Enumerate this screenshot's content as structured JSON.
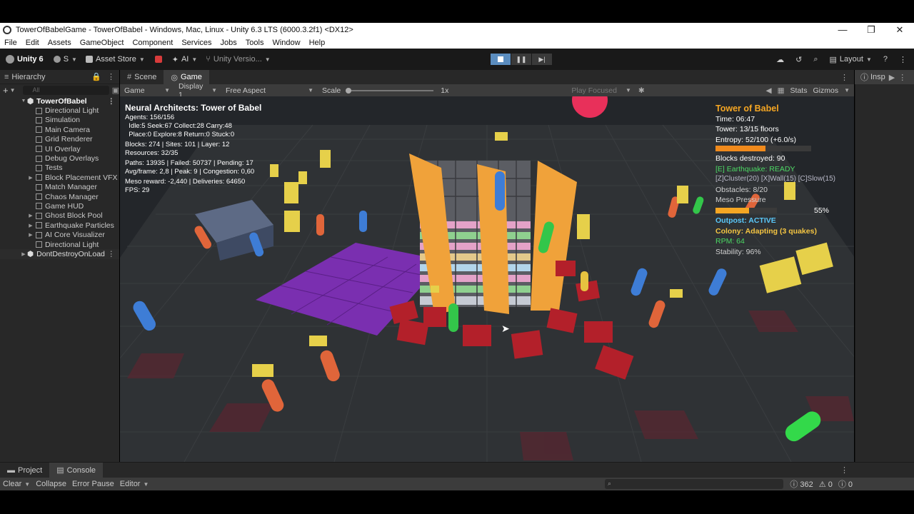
{
  "window": {
    "title": "TowerOfBabelGame - TowerOfBabel - Windows, Mac, Linux - Unity 6.3 LTS (6000.3.2f1) <DX12>",
    "controls": [
      "—",
      "❐",
      "✕"
    ]
  },
  "menu": [
    "File",
    "Edit",
    "Assets",
    "GameObject",
    "Component",
    "Services",
    "Jobs",
    "Tools",
    "Window",
    "Help"
  ],
  "toolbar": {
    "unity_label": "Unity 6",
    "account_label": "S",
    "asset_store_label": "Asset Store",
    "ai_label": "AI",
    "version_control_label": "Unity Versio...",
    "layout_label": "Layout"
  },
  "hierarchy": {
    "tab_label": "Hierarchy",
    "search_placeholder": "All",
    "root": "TowerOfBabel",
    "items": [
      "Directional Light",
      "Simulation",
      "Main Camera",
      "Grid Renderer",
      "UI Overlay",
      "Debug Overlays",
      "Tests",
      "Block Placement VFX",
      "Match Manager",
      "Chaos Manager",
      "Game HUD",
      "Ghost Block Pool",
      "Earthquake Particles",
      "AI Core Visualizer",
      "Directional Light"
    ],
    "expandable": [
      false,
      false,
      false,
      false,
      false,
      false,
      false,
      true,
      false,
      false,
      false,
      true,
      true,
      true,
      false
    ],
    "dont_destroy": "DontDestroyOnLoad"
  },
  "game_view": {
    "tabs": [
      "Scene",
      "Game"
    ],
    "mode": "Game",
    "display": "Display 1",
    "aspect": "Free Aspect",
    "scale_label": "Scale",
    "scale_value": "1x",
    "play_focused": "Play Focused",
    "stats_label": "Stats",
    "gizmos_label": "Gizmos"
  },
  "inspector": {
    "tab_label": "Insp"
  },
  "hud_left": {
    "title": "Neural Architects: Tower of Babel",
    "lines": [
      "Agents: 156/156",
      "  Idle:5 Seek:67 Collect:28 Carry:48",
      "  Place:0 Explore:8 Return:0 Stuck:0",
      "Blocks: 274 | Sites: 101 | Layer: 12",
      "Resources: 32/35",
      "Paths: 13935 | Failed: 50737 | Pending: 17",
      "Avg/frame: 2,8 | Peak: 9 | Congestion: 0,60",
      "Meso reward: -2,440 | Deliveries: 64650",
      "FPS: 29"
    ]
  },
  "hud_right": {
    "title": "Tower of Babel",
    "time": "Time: 06:47",
    "tower": "Tower: 13/15 floors",
    "entropy": "Entropy: 52/100  (+6.0/s)",
    "entropy_level": 0.52,
    "blocks_destroyed": "Blocks destroyed: 90",
    "earthquake": "[E] Earthquake: READY",
    "commands": "[Z]Cluster(20) [X]Wall(15) [C]Slow(15)",
    "obstacles": "Obstacles: 8/20",
    "meso_pressure": "Meso Pressure",
    "meso_pressure_pct": "55%",
    "meso_pressure_level": 0.55,
    "outpost": "Outpost: ACTIVE",
    "colony": "Colony: Adapting (3 quakes)",
    "rpm": "RPM: 64",
    "stability": "Stability: 96%",
    "colors": {
      "title": "#f5a623",
      "earthquake": "#4cd964",
      "outpost": "#5ac8fa",
      "colony": "#f5c542",
      "rpm": "#4cd964",
      "entropy_bar": "#f08a1c",
      "pressure_bar": "#f5a623"
    }
  },
  "bottom": {
    "tabs": [
      "Project",
      "Console"
    ],
    "console_items": [
      "Clear",
      "Collapse",
      "Error Pause",
      "Editor"
    ],
    "counts": {
      "logs": "362",
      "warnings": "0",
      "errors": "0"
    }
  }
}
